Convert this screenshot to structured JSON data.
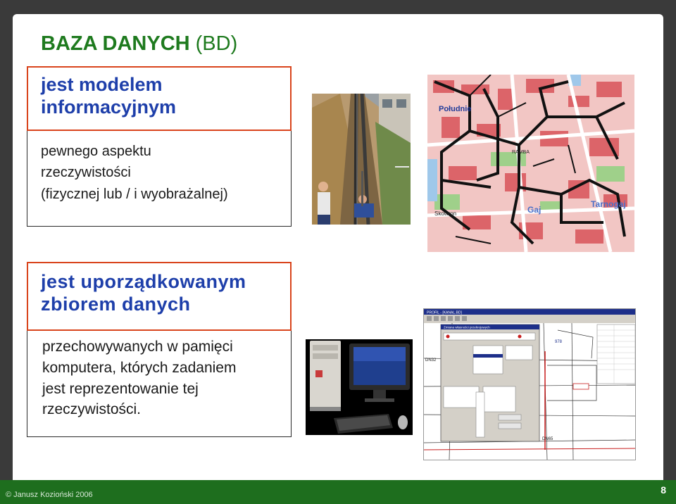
{
  "title": {
    "main": "BAZA  DANYCH",
    "suffix": " (BD)"
  },
  "block1": {
    "heading_line1": "jest modelem",
    "heading_line2": "informacyjnym",
    "line1": "pewnego aspektu",
    "line2": "rzeczywistości",
    "line3": "(fizycznej lub / i wyobrażalnej)"
  },
  "block2": {
    "heading_line1": "jest uporządkowanym",
    "heading_line2": "zbiorem danych",
    "line1": "przechowywanych w pamięci",
    "line2": "komputera, których zadaniem",
    "line3": "jest reprezentowanie tej",
    "line4": "rzeczywistości."
  },
  "map": {
    "label_poludnie": "Południe",
    "label_gaj": "Gaj",
    "label_tarnogaj": "Tarnogaj",
    "label_skowronia": "Skowron",
    "label_ramka": "RAMBA"
  },
  "cad": {
    "title_bar": "PROFIL - [KANAL.BD]",
    "dialog_title": "Zmiana własności przekrojowych",
    "num_978": "978",
    "num_dn32": "DN32",
    "num_dn65": "DN65"
  },
  "footer": {
    "copyright": "© Janusz Kozioński 2006",
    "page": "8"
  },
  "colors": {
    "title_green": "#1e7a1e",
    "heading_blue": "#1e3faa",
    "box_border_red": "#d9441c",
    "footer_green": "#1e6e1e"
  }
}
